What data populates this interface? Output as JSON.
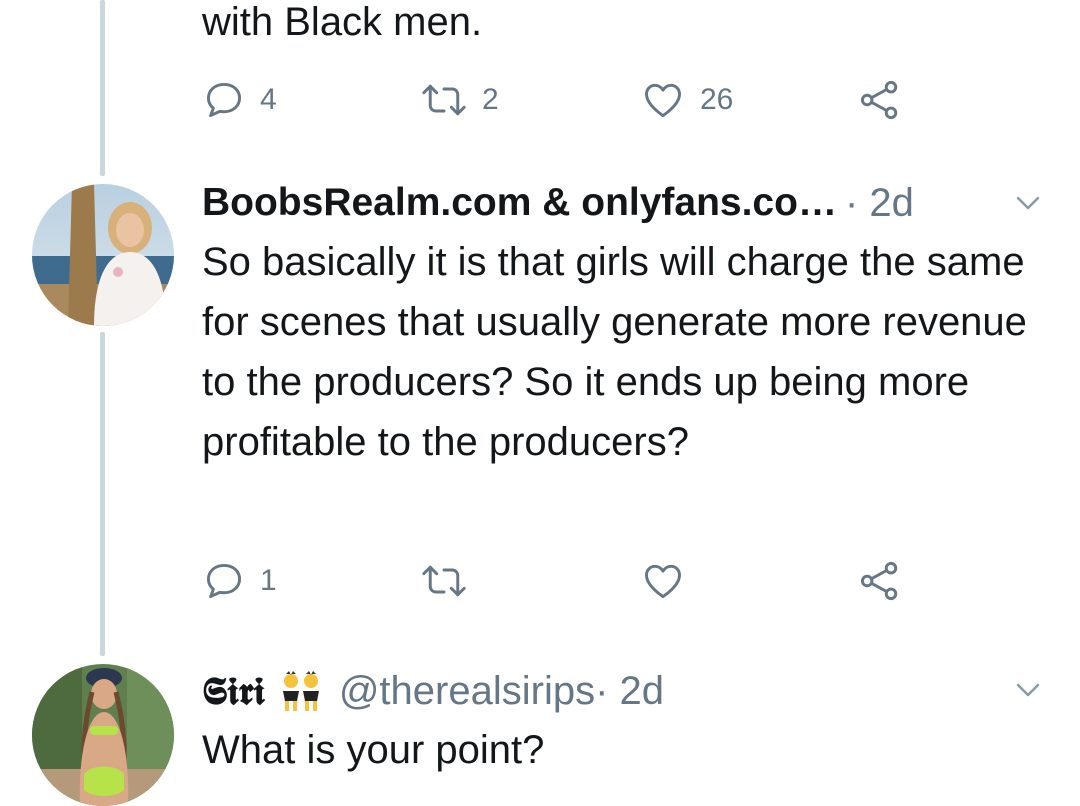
{
  "tweet_top": {
    "text": "with Black men.",
    "actions": {
      "reply_count": "4",
      "retweet_count": "2",
      "like_count": "26"
    }
  },
  "tweet_reply_1": {
    "author_name": "BoobsRealm.com & onlyfans.co…",
    "meta": " · 2d",
    "text": "So basically it is that girls will charge the same for scenes that usually generate more revenue to the producers? So it ends up being more profitable to the producers?",
    "actions": {
      "reply_count": "1",
      "retweet_count": "",
      "like_count": ""
    }
  },
  "tweet_reply_2": {
    "author_name": "𝕾𝖎𝖗𝖎",
    "author_emoji": "twins-emoji",
    "handle": "@therealsirips",
    "meta": " · 2d",
    "text": "What is your point?"
  },
  "icons": {
    "reply": "reply-icon",
    "retweet": "retweet-icon",
    "like": "heart-icon",
    "share": "share-icon",
    "caret": "chevron-down-icon"
  },
  "colors": {
    "text_primary": "#14171a",
    "text_secondary": "#657786",
    "thread_line": "#ccd6dd"
  }
}
